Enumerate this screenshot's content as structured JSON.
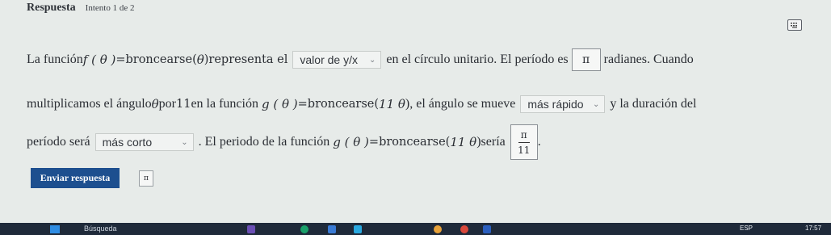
{
  "header": {
    "title": "Respuesta",
    "attempt": "Intento 1 de 2"
  },
  "question": {
    "line1": {
      "t1": "La función ",
      "f1": "f ( θ ) ",
      "t2": "=broncearse( ",
      "f2": "θ ",
      "t3": ")representa el ",
      "dropdown1": "valor de y/x",
      "t4": " en el círculo unitario. El período es ",
      "answer_box": "π",
      "t5": " radianes. Cuando"
    },
    "line2": {
      "t1": "multiplicamos el ángulo",
      "f1": "θ",
      "t2": "por",
      "n1": "11",
      "t3": "en la función",
      "f2": "g ( θ ) ",
      "t4": "=broncearse( ",
      "f3": "11 θ ",
      "t5": "), el ángulo se mueve ",
      "dropdown2": "más rápido",
      "t6": " y la duración del"
    },
    "line3": {
      "t1": "período será ",
      "dropdown3": "más corto",
      "t2": ". El periodo de la función",
      "f1": "g ( θ ) ",
      "t3": "=broncearse( ",
      "f2": "11 θ ",
      "t4": ")sería",
      "frac_num": "π",
      "frac_den": "11",
      "t5": "."
    }
  },
  "submit_label": "Enviar respuesta",
  "preview_symbol": "π",
  "taskbar": {
    "search": "Búsqueda",
    "lang": "ESP",
    "time": "17:57"
  }
}
